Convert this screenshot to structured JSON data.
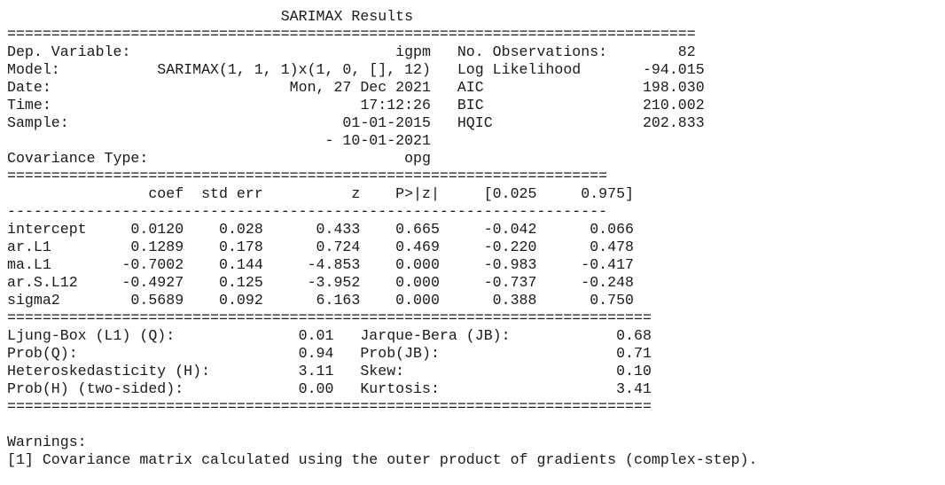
{
  "report": {
    "title": "SARIMAX Results",
    "model_info": {
      "left": [
        {
          "label": "Dep. Variable:",
          "value": "igpm"
        },
        {
          "label": "Model:",
          "value": "SARIMAX(1, 1, 1)x(1, 0, [], 12)"
        },
        {
          "label": "Date:",
          "value": "Mon, 27 Dec 2021"
        },
        {
          "label": "Time:",
          "value": "17:12:26"
        },
        {
          "label": "Sample:",
          "value": "01-01-2015"
        },
        {
          "label": "",
          "value": "- 10-01-2021"
        },
        {
          "label": "Covariance Type:",
          "value": "opg"
        }
      ],
      "right": [
        {
          "label": "No. Observations:",
          "value": "82"
        },
        {
          "label": "Log Likelihood",
          "value": "-94.015"
        },
        {
          "label": "AIC",
          "value": "198.030"
        },
        {
          "label": "BIC",
          "value": "210.002"
        },
        {
          "label": "HQIC",
          "value": "202.833"
        }
      ]
    },
    "coef_table": {
      "headers": [
        "",
        "coef",
        "std err",
        "z",
        "P>|z|",
        "[0.025",
        "0.975]"
      ],
      "rows": [
        [
          "intercept",
          "0.0120",
          "0.028",
          "0.433",
          "0.665",
          "-0.042",
          "0.066"
        ],
        [
          "ar.L1",
          "0.1289",
          "0.178",
          "0.724",
          "0.469",
          "-0.220",
          "0.478"
        ],
        [
          "ma.L1",
          "-0.7002",
          "0.144",
          "-4.853",
          "0.000",
          "-0.983",
          "-0.417"
        ],
        [
          "ar.S.L12",
          "-0.4927",
          "0.125",
          "-3.952",
          "0.000",
          "-0.737",
          "-0.248"
        ],
        [
          "sigma2",
          "0.5689",
          "0.092",
          "6.163",
          "0.000",
          "0.388",
          "0.750"
        ]
      ]
    },
    "diagnostics": [
      {
        "l_label": "Ljung-Box (L1) (Q):",
        "l_value": "0.01",
        "r_label": "Jarque-Bera (JB):",
        "r_value": "0.68"
      },
      {
        "l_label": "Prob(Q):",
        "l_value": "0.94",
        "r_label": "Prob(JB):",
        "r_value": "0.71"
      },
      {
        "l_label": "Heteroskedasticity (H):",
        "l_value": "3.11",
        "r_label": "Skew:",
        "r_value": "0.10"
      },
      {
        "l_label": "Prob(H) (two-sided):",
        "l_value": "0.00",
        "r_label": "Kurtosis:",
        "r_value": "3.41"
      }
    ],
    "warnings_title": "Warnings:",
    "warnings": [
      "[1] Covariance matrix calculated using the outer product of gradients (complex-step)."
    ]
  }
}
